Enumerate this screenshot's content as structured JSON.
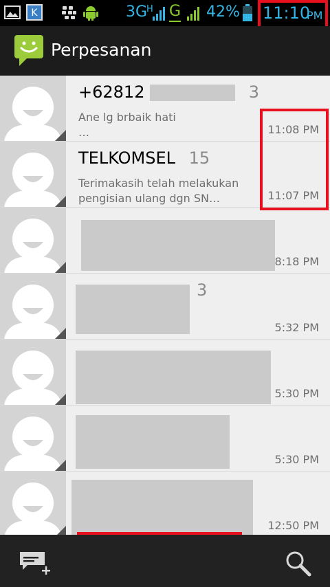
{
  "status_bar": {
    "network_3g": "3G",
    "network_h": "H",
    "network_g": "G",
    "battery": "42%",
    "time": "11:10",
    "time_suffix": "PM"
  },
  "app": {
    "title": "Perpesanan"
  },
  "conversations": [
    {
      "name": "+62812",
      "count": "3",
      "snippet": "Ane lg brbaik hati\n…",
      "time": "11:08 PM"
    },
    {
      "name": "TELKOMSEL",
      "count": "15",
      "snippet": "Terimakasih telah melakukan pengisian ulang dgn SN…",
      "time": "11:07 PM"
    },
    {
      "name": "",
      "count": "",
      "snippet": "",
      "time": "8:18 PM"
    },
    {
      "name": "",
      "count": "3",
      "snippet": "",
      "time": "5:32 PM"
    },
    {
      "name": "",
      "count": "",
      "snippet": "",
      "time": "5:30 PM"
    },
    {
      "name": "",
      "count": "",
      "snippet": "",
      "time": "5:30 PM"
    },
    {
      "name": "",
      "count": "",
      "snippet": "",
      "time": "12:50 PM"
    }
  ],
  "icons": {
    "app": "message-bubble-icon",
    "compose": "new-message-icon",
    "search": "search-icon"
  },
  "colors": {
    "status_accent": "#33b5e5",
    "signal_green": "#8bcb2b",
    "highlight_red": "#e8101e",
    "app_logo_green": "#9ccc3c"
  }
}
